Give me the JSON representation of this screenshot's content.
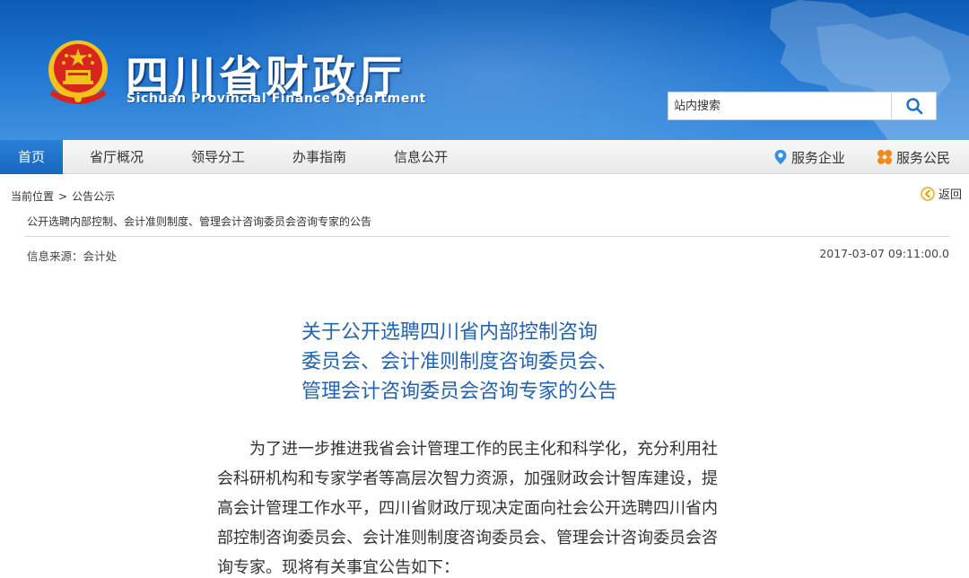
{
  "header": {
    "title": "四川省财政厅",
    "subtitle": "Sichuan Provincial Finance Department",
    "search_placeholder": "站内搜索"
  },
  "nav": {
    "items": [
      "首页",
      "省厅概况",
      "领导分工",
      "办事指南",
      "信息公开"
    ],
    "active_index": 0,
    "right": [
      {
        "label": "服务企业",
        "icon": "location-pin-icon"
      },
      {
        "label": "服务公民",
        "icon": "flower-icon"
      }
    ]
  },
  "breadcrumb": {
    "prefix": "当前位置",
    "separator": ">",
    "current": "公告公示"
  },
  "back_label": "返回",
  "page_heading": "公开选聘内部控制、会计准则制度、管理会计咨询委员会咨询专家的公告",
  "meta": {
    "source": "信息来源：会计处",
    "date": "2017-03-07 09:11:00.0"
  },
  "article": {
    "title_lines": [
      "关于公开选聘四川省内部控制咨询",
      "委员会、会计准则制度咨询委员会、",
      "管理会计咨询委员会咨询专家的公告"
    ],
    "body_lines": [
      "　　为了进一步推进我省会计管理工作的民主化和科学化，充分利用社",
      "会科研机构和专家学者等高层次智力资源，加强财政会计智库建设，提",
      "高会计管理工作水平，四川省财政厅现决定面向社会公开选聘四川省内",
      "部控制咨询委员会、会计准则制度咨询委员会、管理会计咨询委员会咨",
      "询专家。现将有关事宜公告如下："
    ]
  },
  "colors": {
    "banner": "#1f74cf",
    "nav_active": "#1566bf",
    "title_blue": "#2463b3",
    "emblem_red": "#d7261e",
    "emblem_gold": "#f3c21b"
  }
}
